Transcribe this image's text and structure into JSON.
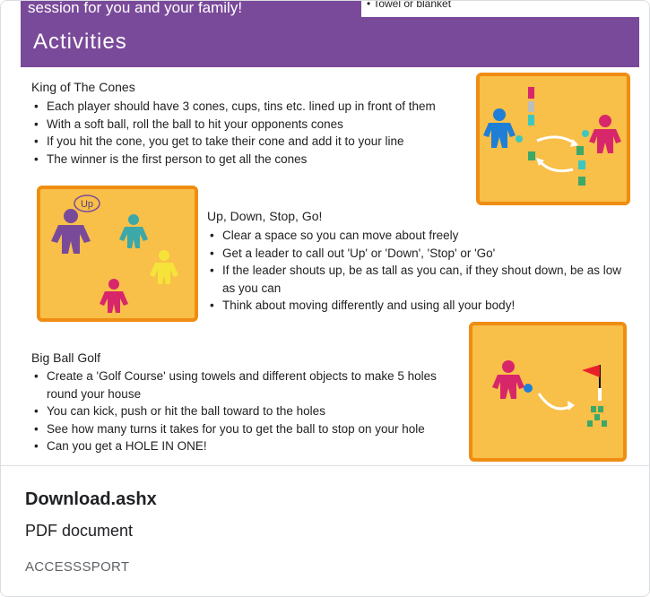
{
  "preview": {
    "top_left_text": "session for you and your family!",
    "top_right_text": "• Towel or blanket",
    "banner_title": "Activities",
    "sections": [
      {
        "title": "King of The Cones",
        "bullets": [
          "Each player should have 3 cones, cups, tins etc. lined up in front of them",
          "With a soft ball, roll the ball to hit your opponents cones",
          "If you hit the cone, you get to take their cone and add it to your line",
          "The winner is the first person to get all the cones"
        ]
      },
      {
        "title": "Up, Down, Stop, Go!",
        "bullets": [
          "Clear a space so you can move about freely",
          "Get a leader to call out 'Up' or 'Down', 'Stop' or 'Go'",
          "If the leader shouts up, be as tall as you can, if they shout down, be as low as you can",
          "Think about moving differently and using all your body!"
        ]
      },
      {
        "title": "Big Ball Golf",
        "bullets": [
          "Create a 'Golf Course' using towels and different objects to make 5 holes round your house",
          "You can kick, push or hit the ball toward to the holes",
          "See how many turns it takes for you to get the ball to stop on your hole",
          "Can you get a HOLE IN ONE!"
        ]
      }
    ],
    "speech_bubble": "Up"
  },
  "file": {
    "name": "Download.ashx",
    "type": "PDF document",
    "source": "ACCESSSPORT"
  },
  "colors": {
    "banner": "#7a4a9a",
    "illustration_fill": "#f8bf49",
    "illustration_border": "#ef8d12"
  }
}
